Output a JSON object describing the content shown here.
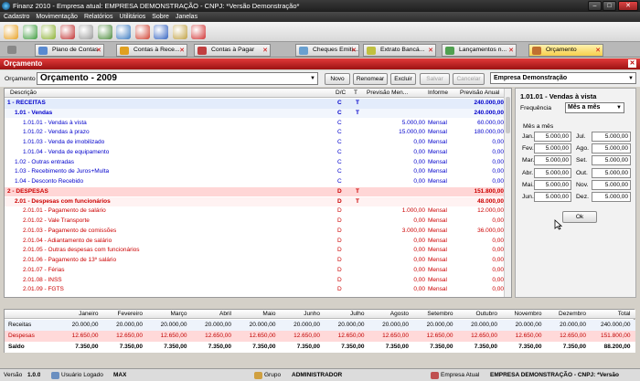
{
  "window": {
    "title": "Finanz 2010 - Empresa atual: EMPRESA DEMONSTRAÇÃO - CNPJ: *Versão Demonstração*",
    "min": "–",
    "max": "□",
    "close": "✕"
  },
  "menu": [
    "Cadastro",
    "Movimentação",
    "Relatórios",
    "Utilitários",
    "Sobre",
    "Janelas"
  ],
  "toolbar_icons": [
    "users-icon",
    "money-icon",
    "exchange-icon",
    "bank-icon",
    "pen-icon",
    "cash-icon",
    "chart-icon",
    "pie-chart-icon",
    "save-icon",
    "key-icon",
    "power-icon"
  ],
  "toolbar_colors": [
    "#e8a020",
    "#3a9a3a",
    "#8ab030",
    "#c03030",
    "#999999",
    "#4a8a3a",
    "#3a7ac0",
    "#d04030",
    "#3060c0",
    "#c0a040",
    "#d03030"
  ],
  "tabs": [
    {
      "label": "Plano de Contas",
      "color": "#5a8ad0",
      "active": false
    },
    {
      "label": "Contas à Rece...",
      "color": "#e0a020",
      "active": false
    },
    {
      "label": "Contas à Pagar",
      "color": "#c04040",
      "active": false
    },
    {
      "label": "Cheques Emiti...",
      "color": "#6aa0d0",
      "active": false
    },
    {
      "label": "Extrato Bancá...",
      "color": "#c0c040",
      "active": false
    },
    {
      "label": "Lançamentos n...",
      "color": "#50a050",
      "active": false
    },
    {
      "label": "Orçamento",
      "color": "#c07030",
      "active": true
    }
  ],
  "form": {
    "title": "Orçamento",
    "close": "✕",
    "orcamento_label": "Orçamento",
    "orcamento_value": "Orçamento - 2009",
    "buttons": {
      "novo": "Novo",
      "renomear": "Renomear",
      "excluir": "Excluir",
      "salvar": "Salvar",
      "cancelar": "Cancelar"
    },
    "empresa": "Empresa Demonstração"
  },
  "grid": {
    "headers": {
      "descricao": "Descrição",
      "dc": "D/C",
      "t": "T",
      "prev_mensal": "Previsão Men...",
      "informe": "Informe",
      "prev_anual": "Previsão Anual"
    },
    "rows": [
      {
        "desc": "1 - RECEITAS",
        "dc": "C",
        "t": "T",
        "pm": "",
        "inf": "",
        "pa": "240.000,00",
        "style": "group-c",
        "indent": 0
      },
      {
        "desc": "1.01 - Vendas",
        "dc": "C",
        "t": "T",
        "pm": "",
        "inf": "",
        "pa": "240.000,00",
        "style": "sub-c",
        "indent": 1
      },
      {
        "desc": "1.01.01 - Vendas à vista",
        "dc": "C",
        "t": "",
        "pm": "5.000,00",
        "inf": "Mensal",
        "pa": "60.000,00",
        "style": "item-c",
        "indent": 2
      },
      {
        "desc": "1.01.02 - Vendas à prazo",
        "dc": "C",
        "t": "",
        "pm": "15.000,00",
        "inf": "Mensal",
        "pa": "180.000,00",
        "style": "item-c",
        "indent": 2
      },
      {
        "desc": "1.01.03 - Venda de imobilizado",
        "dc": "C",
        "t": "",
        "pm": "0,00",
        "inf": "Mensal",
        "pa": "0,00",
        "style": "item-c",
        "indent": 2
      },
      {
        "desc": "1.01.04 - Venda de equipamento",
        "dc": "C",
        "t": "",
        "pm": "0,00",
        "inf": "Mensal",
        "pa": "0,00",
        "style": "item-c",
        "indent": 2
      },
      {
        "desc": "1.02 - Outras entradas",
        "dc": "C",
        "t": "",
        "pm": "0,00",
        "inf": "Mensal",
        "pa": "0,00",
        "style": "item-c",
        "indent": 1
      },
      {
        "desc": "1.03 - Recebimento de Juros+Multa",
        "dc": "C",
        "t": "",
        "pm": "0,00",
        "inf": "Mensal",
        "pa": "0,00",
        "style": "item-c",
        "indent": 1
      },
      {
        "desc": "1.04 - Desconto Recebido",
        "dc": "C",
        "t": "",
        "pm": "0,00",
        "inf": "Mensal",
        "pa": "0,00",
        "style": "item-c",
        "indent": 1
      },
      {
        "desc": "2 - DESPESAS",
        "dc": "D",
        "t": "T",
        "pm": "",
        "inf": "",
        "pa": "151.800,00",
        "style": "group-d",
        "indent": 0
      },
      {
        "desc": "2.01 - Despesas com funcionários",
        "dc": "D",
        "t": "T",
        "pm": "",
        "inf": "",
        "pa": "48.000,00",
        "style": "sub-d",
        "indent": 1
      },
      {
        "desc": "2.01.01 - Pagamento de salário",
        "dc": "D",
        "t": "",
        "pm": "1.000,00",
        "inf": "Mensal",
        "pa": "12.000,00",
        "style": "item-d",
        "indent": 2
      },
      {
        "desc": "2.01.02 - Vale Transporte",
        "dc": "D",
        "t": "",
        "pm": "0,00",
        "inf": "Mensal",
        "pa": "0,00",
        "style": "item-d",
        "indent": 2
      },
      {
        "desc": "2.01.03 - Pagamento de comissões",
        "dc": "D",
        "t": "",
        "pm": "3.000,00",
        "inf": "Mensal",
        "pa": "36.000,00",
        "style": "item-d",
        "indent": 2
      },
      {
        "desc": "2.01.04 - Adiantamento de salário",
        "dc": "D",
        "t": "",
        "pm": "0,00",
        "inf": "Mensal",
        "pa": "0,00",
        "style": "item-d",
        "indent": 2
      },
      {
        "desc": "2.01.05 - Outras despesas com funcionários",
        "dc": "D",
        "t": "",
        "pm": "0,00",
        "inf": "Mensal",
        "pa": "0,00",
        "style": "item-d",
        "indent": 2
      },
      {
        "desc": "2.01.06 - Pagamento de 13º salário",
        "dc": "D",
        "t": "",
        "pm": "0,00",
        "inf": "Mensal",
        "pa": "0,00",
        "style": "item-d",
        "indent": 2
      },
      {
        "desc": "2.01.07 - Férias",
        "dc": "D",
        "t": "",
        "pm": "0,00",
        "inf": "Mensal",
        "pa": "0,00",
        "style": "item-d",
        "indent": 2
      },
      {
        "desc": "2.01.08 - INSS",
        "dc": "D",
        "t": "",
        "pm": "0,00",
        "inf": "Mensal",
        "pa": "0,00",
        "style": "item-d",
        "indent": 2
      },
      {
        "desc": "2.01.09 - FGTS",
        "dc": "D",
        "t": "",
        "pm": "0,00",
        "inf": "Mensal",
        "pa": "0,00",
        "style": "item-d",
        "indent": 2
      }
    ]
  },
  "right": {
    "title": "1.01.01 - Vendas à vista",
    "freq_label": "Frequência",
    "freq_value": "Mês a mês",
    "group_label": "Mês a mês",
    "months": [
      {
        "l": "Jan.",
        "v": "5.000,00"
      },
      {
        "l": "Jul.",
        "v": "5.000,00"
      },
      {
        "l": "Fev.",
        "v": "5.000,00"
      },
      {
        "l": "Ago.",
        "v": "5.000,00"
      },
      {
        "l": "Mar.",
        "v": "5.000,00"
      },
      {
        "l": "Set.",
        "v": "5.000,00"
      },
      {
        "l": "Abr.",
        "v": "5.000,00"
      },
      {
        "l": "Out.",
        "v": "5.000,00"
      },
      {
        "l": "Mai.",
        "v": "5.000,00"
      },
      {
        "l": "Nov.",
        "v": "5.000,00"
      },
      {
        "l": "Jun.",
        "v": "5.000,00"
      },
      {
        "l": "Dez.",
        "v": "5.000,00"
      }
    ],
    "ok": "Ok"
  },
  "summary": {
    "headers": [
      "Janeiro",
      "Fevereiro",
      "Março",
      "Abril",
      "Maio",
      "Junho",
      "Julho",
      "Agosto",
      "Setembro",
      "Outubro",
      "Novembro",
      "Dezembro",
      "Total"
    ],
    "rows": [
      {
        "label": "Receitas",
        "vals": [
          "20.000,00",
          "20.000,00",
          "20.000,00",
          "20.000,00",
          "20.000,00",
          "20.000,00",
          "20.000,00",
          "20.000,00",
          "20.000,00",
          "20.000,00",
          "20.000,00",
          "20.000,00",
          "240.000,00"
        ],
        "bg": "#eef3fb",
        "color": "#000",
        "bold": false
      },
      {
        "label": "Despesas",
        "vals": [
          "12.650,00",
          "12.650,00",
          "12.650,00",
          "12.650,00",
          "12.650,00",
          "12.650,00",
          "12.650,00",
          "12.650,00",
          "12.650,00",
          "12.650,00",
          "12.650,00",
          "12.650,00",
          "151.800,00"
        ],
        "bg": "#ffd9d9",
        "color": "#c00000",
        "bold": false
      },
      {
        "label": "Saldo",
        "vals": [
          "7.350,00",
          "7.350,00",
          "7.350,00",
          "7.350,00",
          "7.350,00",
          "7.350,00",
          "7.350,00",
          "7.350,00",
          "7.350,00",
          "7.350,00",
          "7.350,00",
          "7.350,00",
          "88.200,00"
        ],
        "bg": "#ffffff",
        "color": "#000",
        "bold": true
      }
    ]
  },
  "status": {
    "versao_label": "Versão",
    "versao": "1.0.0",
    "usuario_label": "Usuário Logado",
    "usuario": "MAX",
    "grupo_label": "Grupo",
    "grupo": "ADMINISTRADOR",
    "empresa_label": "Empresa Atual",
    "empresa": "EMPRESA DEMONSTRAÇÃO - CNPJ: *Versão"
  },
  "colors": {
    "receita": "#0000cc",
    "despesa": "#cc0000",
    "group_c_bg": "#e3ecfb",
    "group_d_bg": "#ffd6d6",
    "accent_title": "#b01818"
  }
}
